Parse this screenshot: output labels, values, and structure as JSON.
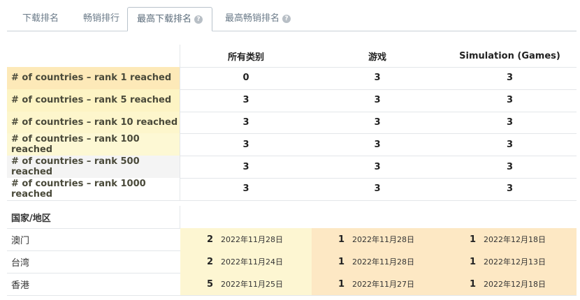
{
  "tabs": [
    {
      "label": "下载排名",
      "help": false
    },
    {
      "label": "畅销排行",
      "help": false
    },
    {
      "label": "最高下载排名",
      "help": true,
      "active": true
    },
    {
      "label": "最高畅销排名",
      "help": true
    }
  ],
  "columns": [
    "所有类别",
    "游戏",
    "Simulation (Games)"
  ],
  "rank_rows": [
    {
      "label": "# of countries – rank 1 reached",
      "values": [
        "0",
        "3",
        "3"
      ],
      "color": "#fde9b8"
    },
    {
      "label": "# of countries – rank 5 reached",
      "values": [
        "3",
        "3",
        "3"
      ],
      "color": "#fdf4c4"
    },
    {
      "label": "# of countries – rank 10 reached",
      "values": [
        "3",
        "3",
        "3"
      ],
      "color": "#fdf6cc"
    },
    {
      "label": "# of countries – rank 100 reached",
      "values": [
        "3",
        "3",
        "3"
      ],
      "color": "#fdf8d4"
    },
    {
      "label": "# of countries – rank 500 reached",
      "values": [
        "3",
        "3",
        "3"
      ],
      "color": "#f4f4f4"
    },
    {
      "label": "# of countries – rank 1000 reached",
      "values": [
        "3",
        "3",
        "3"
      ],
      "color": "#ffffff"
    }
  ],
  "country_header": "国家/地区",
  "countries": [
    {
      "name": "澳门",
      "cells": [
        {
          "rank": "2",
          "date": "2022年11月28日"
        },
        {
          "rank": "1",
          "date": "2022年11月28日"
        },
        {
          "rank": "1",
          "date": "2022年12月18日"
        }
      ]
    },
    {
      "name": "台湾",
      "cells": [
        {
          "rank": "2",
          "date": "2022年11月24日"
        },
        {
          "rank": "1",
          "date": "2022年11月28日"
        },
        {
          "rank": "1",
          "date": "2022年12月13日"
        }
      ]
    },
    {
      "name": "香港",
      "cells": [
        {
          "rank": "5",
          "date": "2022年11月25日"
        },
        {
          "rank": "1",
          "date": "2022年11月27日"
        },
        {
          "rank": "1",
          "date": "2022年12月18日"
        }
      ]
    }
  ],
  "colors": {
    "rank2_5": "#fdf6d2",
    "rank1": "#fde8c4"
  }
}
